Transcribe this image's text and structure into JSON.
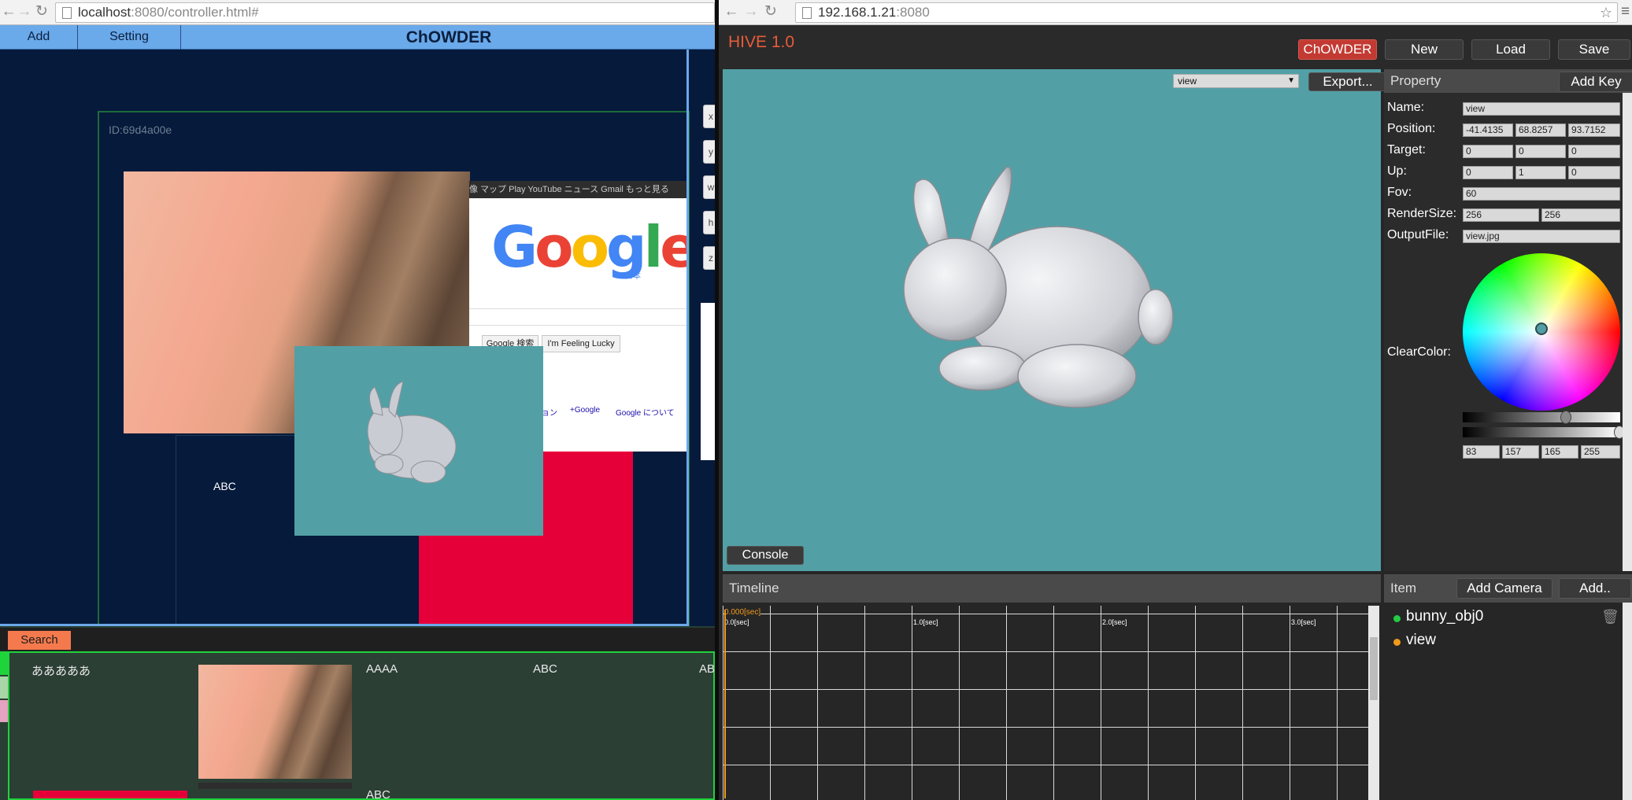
{
  "left_browser": {
    "url_host": "localhost",
    "url_rest": ":8080/controller.html#",
    "menu": {
      "add": "Add",
      "setting": "Setting",
      "title": "ChOWDER"
    },
    "canvas": {
      "window_id": "ID:69d4a00e",
      "abc_label": "ABC",
      "google": {
        "bar_links": "像 マップ Play YouTube ニュース Gmail もっと見る",
        "logo": [
          "G",
          "o",
          "o",
          "g",
          "l",
          "e"
        ],
        "logo_sub": "日本",
        "search_btn": "Google 検索",
        "lucky_btn": "I'm Feeling Lucky",
        "link1": "ョン",
        "link2": "+Google",
        "link3": "Google について"
      },
      "side_buttons": [
        "x",
        "y",
        "w",
        "h",
        "z"
      ]
    },
    "bottom": {
      "search_label": "Search",
      "items": [
        "あああああ",
        "AAAA",
        "ABC",
        "AB",
        "ABC"
      ]
    }
  },
  "right_browser": {
    "url_host": "192.168.1.21",
    "url_port": ":8080",
    "hive_title": "HIVE 1.0",
    "top_buttons": {
      "chowder": "ChOWDER",
      "new": "New",
      "load": "Load",
      "save": "Save"
    },
    "viewport": {
      "view_select": "view",
      "export": "Export...",
      "console": "Console"
    },
    "property": {
      "title": "Property",
      "add_key": "Add Key",
      "name_label": "Name:",
      "name_value": "view",
      "position_label": "Position:",
      "position": [
        "-41.4135",
        "68.8257",
        "93.7152"
      ],
      "target_label": "Target:",
      "target": [
        "0",
        "0",
        "0"
      ],
      "up_label": "Up:",
      "up": [
        "0",
        "1",
        "0"
      ],
      "fov_label": "Fov:",
      "fov": "60",
      "rendersize_label": "RenderSize:",
      "rendersize": [
        "256",
        "256"
      ],
      "outputfile_label": "OutputFile:",
      "outputfile": "view.jpg",
      "clearcolor_label": "ClearColor:",
      "clearcolor_rgba": [
        "83",
        "157",
        "165",
        "255"
      ],
      "clearcolor_hex": "#539da5"
    },
    "timeline": {
      "title": "Timeline",
      "current": "0.000[sec]",
      "ticks": [
        "0.0[sec]",
        "1.0[sec]",
        "2.0[sec]",
        "3.0[sec]"
      ]
    },
    "items": {
      "title": "Item",
      "add_camera": "Add Camera",
      "add": "Add..",
      "list": [
        {
          "name": "bunny_obj0",
          "color": "#22cc44"
        },
        {
          "name": "view",
          "color": "#f09a1a"
        }
      ]
    }
  },
  "colors": {
    "chowder_menu": "#6aa9ea",
    "hive_title": "#e85c3a",
    "search_btn": "#f47a4e",
    "viewport_bg": "#52a0a6"
  }
}
